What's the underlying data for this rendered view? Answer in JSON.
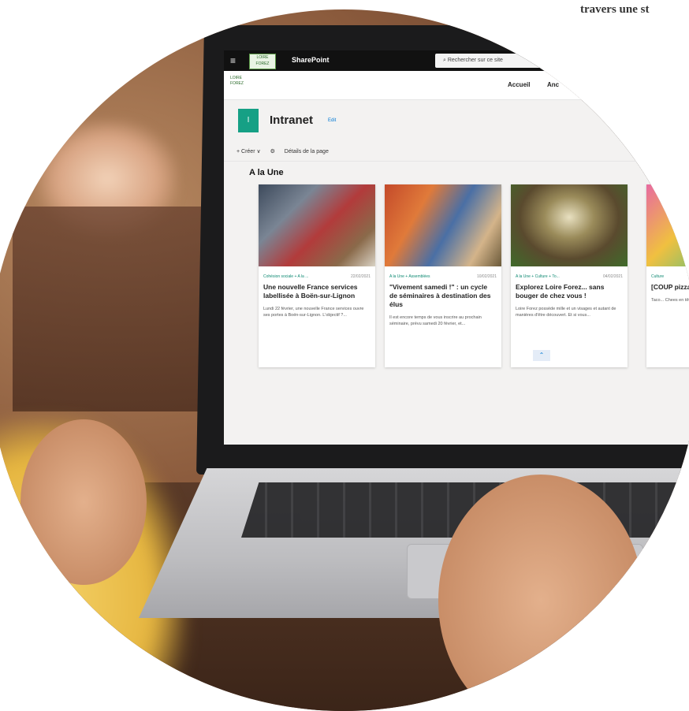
{
  "corner_text": "travers une st",
  "suitebar": {
    "waffle": "≡",
    "logo": "LOIRE FOREZ",
    "app_name": "SharePoint",
    "search_placeholder": "Rechercher sur ce site"
  },
  "header": {
    "logo": "LOIRE FOREZ",
    "nav": [
      "Accueil",
      "Anc"
    ]
  },
  "site": {
    "icon_letter": "I",
    "title": "Intranet",
    "edit": "Edit"
  },
  "commandbar": {
    "create": "+ Créer ∨",
    "details": "Détails de la page"
  },
  "section_title": "A la Une",
  "cards": [
    {
      "meta": "Cohésion sociale + A la ...",
      "date": "22/02/2021",
      "title": "Une nouvelle France services labellisée à Boën-sur-Lignon",
      "desc": "Lundi 22 février, une nouvelle France services ouvre ses portes à Boën-sur-Lignon. L'objectif ?..."
    },
    {
      "meta": "A la Une + Assemblées",
      "date": "10/02/2021",
      "title": "\"Vivement samedi !\" : un cycle de séminaires à destination des élus",
      "desc": "Il est encore temps de vous inscrire au prochain séminaire, prévu samedi 20 février, et..."
    },
    {
      "meta": "A la Une + Culture + To...",
      "date": "04/02/2021",
      "title": "Explorez Loire Forez... sans bouger de chez vous !",
      "desc": "Loire Forez possède mille et un visages et autant de manières d'être découvert. Et si vous..."
    },
    {
      "meta": "Culture",
      "date": "",
      "title": "[COUP pizza... rapidit",
      "desc": "Taco... Chees en tête"
    }
  ],
  "scroll_up_icon": "⌃",
  "colors": {
    "site_accent": "#16a085",
    "link": "#0078d4",
    "suitebar": "#111111"
  }
}
